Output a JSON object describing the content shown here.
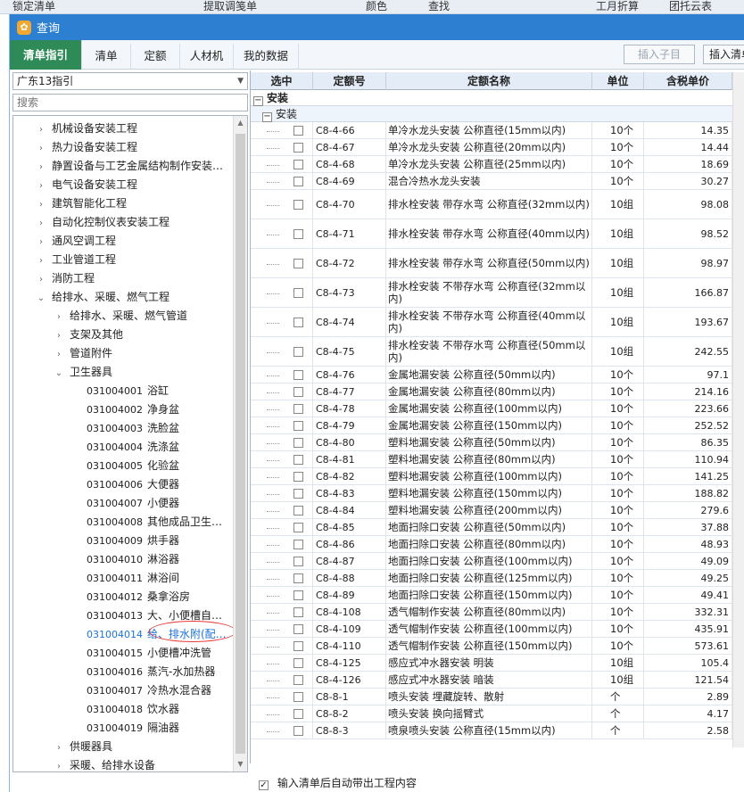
{
  "bg_toolbar": [
    "锁定清单",
    "提取调笺单",
    "颜色",
    "查找",
    "工月折算",
    "团托云表"
  ],
  "window": {
    "title": "查询",
    "icon_glyph": "✿"
  },
  "tabs": [
    "清单指引",
    "清单",
    "定额",
    "人材机",
    "我的数据"
  ],
  "active_tab": 0,
  "buttons": {
    "insert_child": "插入子目",
    "insert_list": "插入清单"
  },
  "left": {
    "dropdown_value": "广东13指引",
    "search_placeholder": "搜索",
    "tree": [
      {
        "level": 1,
        "chev": "›",
        "label": "机械设备安装工程"
      },
      {
        "level": 1,
        "chev": "›",
        "label": "热力设备安装工程"
      },
      {
        "level": 1,
        "chev": "›",
        "label": "静置设备与工艺金属结构制作安装…"
      },
      {
        "level": 1,
        "chev": "›",
        "label": "电气设备安装工程"
      },
      {
        "level": 1,
        "chev": "›",
        "label": "建筑智能化工程"
      },
      {
        "level": 1,
        "chev": "›",
        "label": "自动化控制仪表安装工程"
      },
      {
        "level": 1,
        "chev": "›",
        "label": "通风空调工程"
      },
      {
        "level": 1,
        "chev": "›",
        "label": "工业管道工程"
      },
      {
        "level": 1,
        "chev": "›",
        "label": "消防工程"
      },
      {
        "level": 1,
        "chev": "⌄",
        "label": "给排水、采暖、燃气工程"
      },
      {
        "level": 2,
        "chev": "›",
        "label": "给排水、采暖、燃气管道"
      },
      {
        "level": 2,
        "chev": "›",
        "label": "支架及其他"
      },
      {
        "level": 2,
        "chev": "›",
        "label": "管道附件"
      },
      {
        "level": 2,
        "chev": "⌄",
        "label": "卫生器具"
      },
      {
        "level": 3,
        "code": "031004001",
        "label": "浴缸"
      },
      {
        "level": 3,
        "code": "031004002",
        "label": "净身盆"
      },
      {
        "level": 3,
        "code": "031004003",
        "label": "洗脸盆"
      },
      {
        "level": 3,
        "code": "031004004",
        "label": "洗涤盆"
      },
      {
        "level": 3,
        "code": "031004005",
        "label": "化验盆"
      },
      {
        "level": 3,
        "code": "031004006",
        "label": "大便器"
      },
      {
        "level": 3,
        "code": "031004007",
        "label": "小便器"
      },
      {
        "level": 3,
        "code": "031004008",
        "label": "其他成品卫生…"
      },
      {
        "level": 3,
        "code": "031004009",
        "label": "烘手器"
      },
      {
        "level": 3,
        "code": "031004010",
        "label": "淋浴器"
      },
      {
        "level": 3,
        "code": "031004011",
        "label": "淋浴间"
      },
      {
        "level": 3,
        "code": "031004012",
        "label": "桑拿浴房"
      },
      {
        "level": 3,
        "code": "031004013",
        "label": "大、小便槽自…"
      },
      {
        "level": 3,
        "code": "031004014",
        "label": "给、排水附(配…",
        "selected": true
      },
      {
        "level": 3,
        "code": "031004015",
        "label": "小便槽冲洗管"
      },
      {
        "level": 3,
        "code": "031004016",
        "label": "蒸汽-水加热器"
      },
      {
        "level": 3,
        "code": "031004017",
        "label": "冷热水混合器"
      },
      {
        "level": 3,
        "code": "031004018",
        "label": "饮水器"
      },
      {
        "level": 3,
        "code": "031004019",
        "label": "隔油器"
      },
      {
        "level": 2,
        "chev": "›",
        "label": "供暖器具"
      },
      {
        "level": 2,
        "chev": "›",
        "label": "采暖、给排水设备"
      },
      {
        "level": 2,
        "chev": "›",
        "label": "燃气器具及其他"
      }
    ]
  },
  "grid": {
    "headers": [
      "选中",
      "定额号",
      "定额名称",
      "单位",
      "含税单价"
    ],
    "group1": "安装",
    "group2": "安装",
    "group_box": "−",
    "rows": [
      {
        "code": "C8-4-66",
        "name": "单冷水龙头安装 公称直径(15mm以内)",
        "unit": "10个",
        "price": "14.35"
      },
      {
        "code": "C8-4-67",
        "name": "单冷水龙头安装 公称直径(20mm以内)",
        "unit": "10个",
        "price": "14.44"
      },
      {
        "code": "C8-4-68",
        "name": "单冷水龙头安装 公称直径(25mm以内)",
        "unit": "10个",
        "price": "18.69"
      },
      {
        "code": "C8-4-69",
        "name": "混合冷热水龙头安装",
        "unit": "10个",
        "price": "30.27"
      },
      {
        "code": "C8-4-70",
        "name": "排水栓安装 带存水弯 公称直径(32mm以内)",
        "unit": "10组",
        "price": "98.08",
        "tall": true
      },
      {
        "code": "C8-4-71",
        "name": "排水栓安装 带存水弯 公称直径(40mm以内)",
        "unit": "10组",
        "price": "98.52",
        "tall": true
      },
      {
        "code": "C8-4-72",
        "name": "排水栓安装 带存水弯 公称直径(50mm以内)",
        "unit": "10组",
        "price": "98.97",
        "tall": true
      },
      {
        "code": "C8-4-73",
        "name": "排水栓安装 不带存水弯 公称直径(32mm以内)",
        "unit": "10组",
        "price": "166.87",
        "tall": true
      },
      {
        "code": "C8-4-74",
        "name": "排水栓安装 不带存水弯 公称直径(40mm以内)",
        "unit": "10组",
        "price": "193.67",
        "tall": true
      },
      {
        "code": "C8-4-75",
        "name": "排水栓安装 不带存水弯 公称直径(50mm以内)",
        "unit": "10组",
        "price": "242.55",
        "tall": true
      },
      {
        "code": "C8-4-76",
        "name": "金属地漏安装 公称直径(50mm以内)",
        "unit": "10个",
        "price": "97.1"
      },
      {
        "code": "C8-4-77",
        "name": "金属地漏安装 公称直径(80mm以内)",
        "unit": "10个",
        "price": "214.16"
      },
      {
        "code": "C8-4-78",
        "name": "金属地漏安装 公称直径(100mm以内)",
        "unit": "10个",
        "price": "223.66"
      },
      {
        "code": "C8-4-79",
        "name": "金属地漏安装 公称直径(150mm以内)",
        "unit": "10个",
        "price": "252.52"
      },
      {
        "code": "C8-4-80",
        "name": "塑料地漏安装 公称直径(50mm以内)",
        "unit": "10个",
        "price": "86.35"
      },
      {
        "code": "C8-4-81",
        "name": "塑料地漏安装 公称直径(80mm以内)",
        "unit": "10个",
        "price": "110.94"
      },
      {
        "code": "C8-4-82",
        "name": "塑料地漏安装 公称直径(100mm以内)",
        "unit": "10个",
        "price": "141.25"
      },
      {
        "code": "C8-4-83",
        "name": "塑料地漏安装 公称直径(150mm以内)",
        "unit": "10个",
        "price": "188.82"
      },
      {
        "code": "C8-4-84",
        "name": "塑料地漏安装 公称直径(200mm以内)",
        "unit": "10个",
        "price": "279.6"
      },
      {
        "code": "C8-4-85",
        "name": "地面扫除口安装 公称直径(50mm以内)",
        "unit": "10个",
        "price": "37.88"
      },
      {
        "code": "C8-4-86",
        "name": "地面扫除口安装 公称直径(80mm以内)",
        "unit": "10个",
        "price": "48.93"
      },
      {
        "code": "C8-4-87",
        "name": "地面扫除口安装 公称直径(100mm以内)",
        "unit": "10个",
        "price": "49.09"
      },
      {
        "code": "C8-4-88",
        "name": "地面扫除口安装 公称直径(125mm以内)",
        "unit": "10个",
        "price": "49.25"
      },
      {
        "code": "C8-4-89",
        "name": "地面扫除口安装 公称直径(150mm以内)",
        "unit": "10个",
        "price": "49.41"
      },
      {
        "code": "C8-4-108",
        "name": "透气帽制作安装 公称直径(80mm以内)",
        "unit": "10个",
        "price": "332.31"
      },
      {
        "code": "C8-4-109",
        "name": "透气帽制作安装 公称直径(100mm以内)",
        "unit": "10个",
        "price": "435.91"
      },
      {
        "code": "C8-4-110",
        "name": "透气帽制作安装 公称直径(150mm以内)",
        "unit": "10个",
        "price": "573.61"
      },
      {
        "code": "C8-4-125",
        "name": "感应式冲水器安装 明装",
        "unit": "10组",
        "price": "105.4"
      },
      {
        "code": "C8-4-126",
        "name": "感应式冲水器安装 暗装",
        "unit": "10组",
        "price": "121.54"
      },
      {
        "code": "C8-8-1",
        "name": "喷头安装 埋藏旋转、散射",
        "unit": "个",
        "price": "2.89"
      },
      {
        "code": "C8-8-2",
        "name": "喷头安装 换向摇臂式",
        "unit": "个",
        "price": "4.17"
      },
      {
        "code": "C8-8-3",
        "name": "喷泉喷头安装 公称直径(15mm以内)",
        "unit": "个",
        "price": "2.58"
      }
    ]
  },
  "footer": {
    "checkbox_label": "输入清单后自动带出工程内容",
    "checked": true,
    "check_glyph": "✓"
  }
}
